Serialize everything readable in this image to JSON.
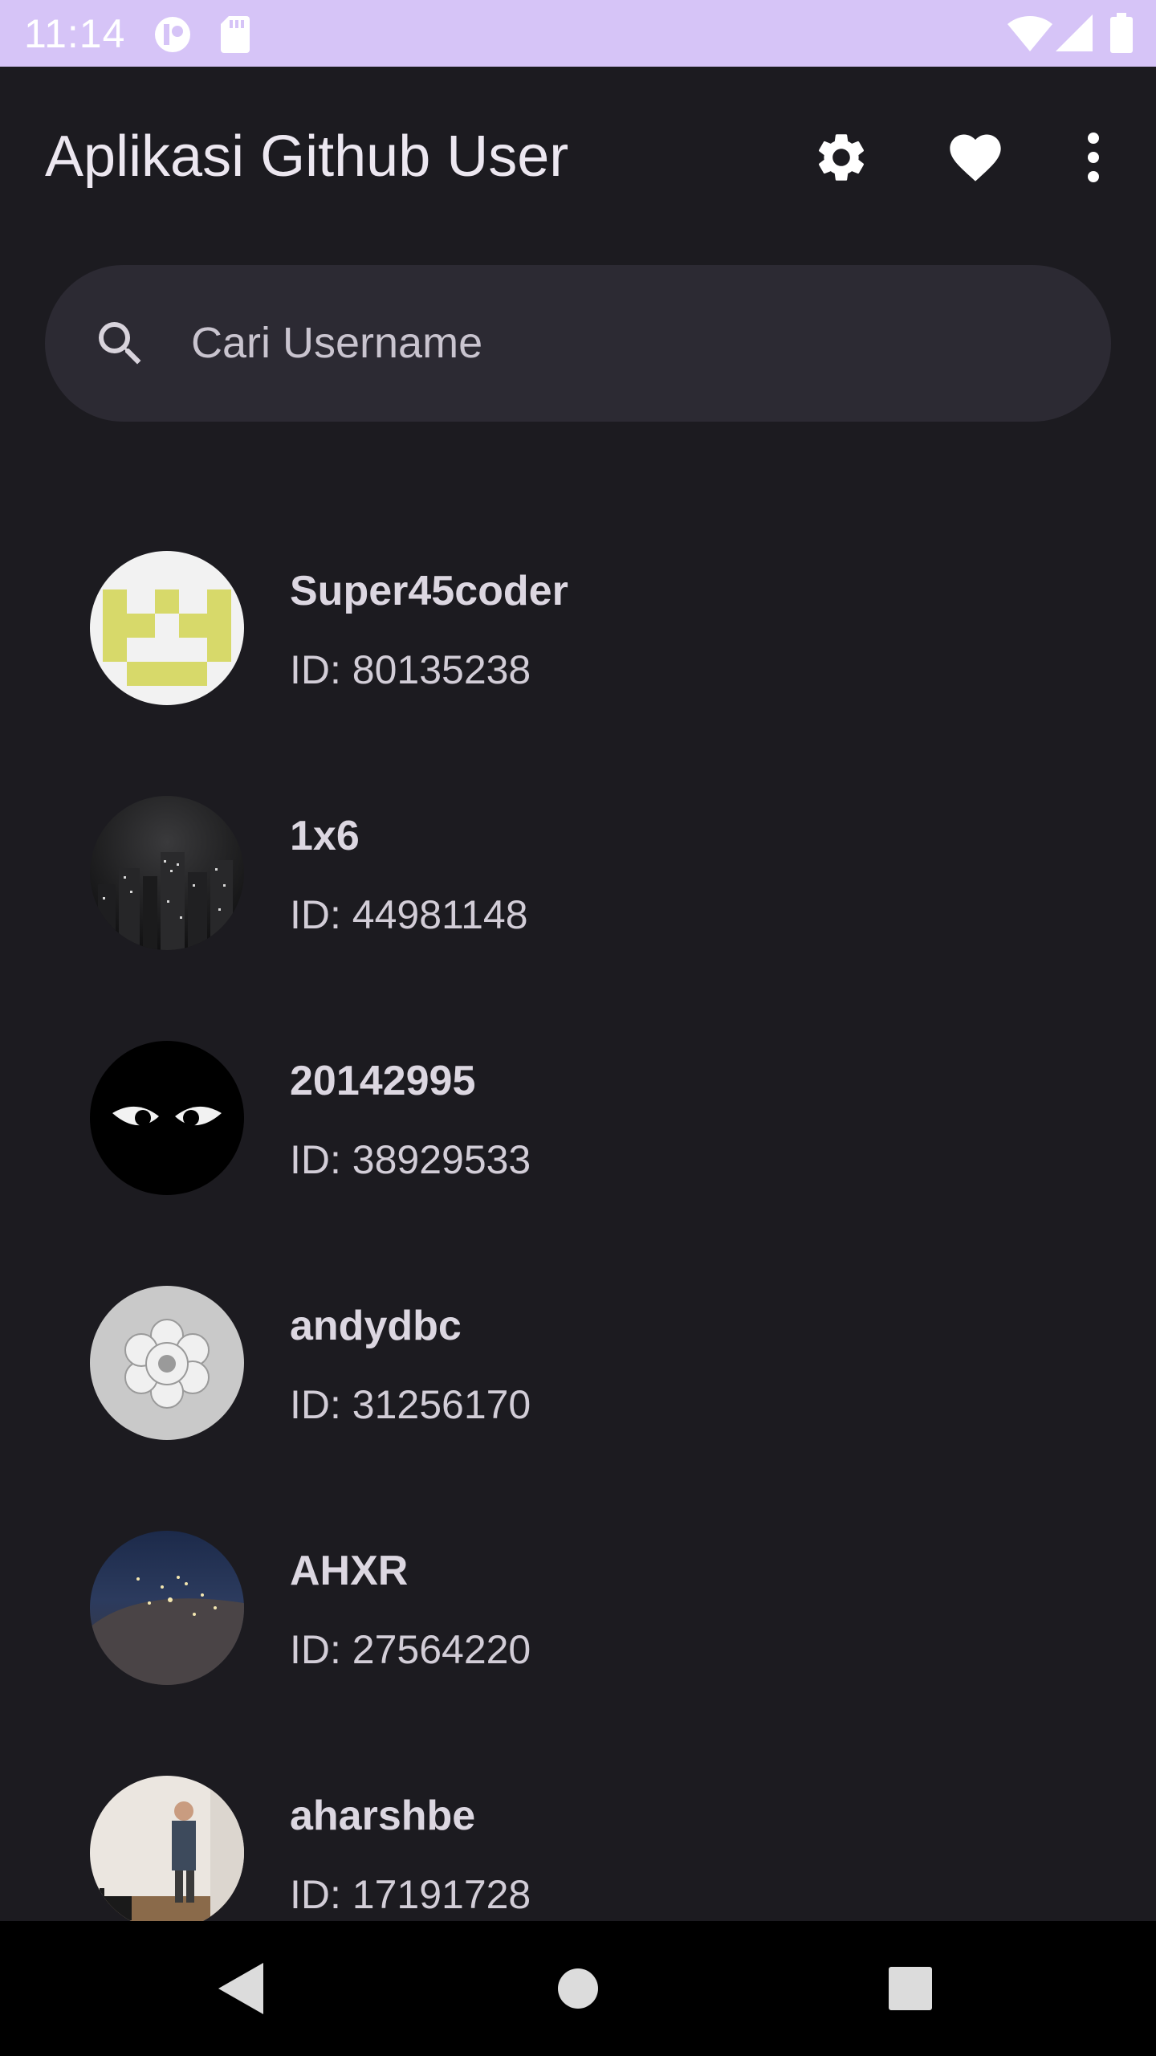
{
  "status_bar": {
    "time": "11:14",
    "background": "#d6c4f7",
    "icons": [
      "notification-app-icon",
      "sd-card-icon",
      "wifi-icon",
      "signal-icon",
      "battery-icon"
    ]
  },
  "app_bar": {
    "title": "Aplikasi Github User",
    "actions": [
      "gear-icon",
      "heart-icon",
      "more-vert-icon"
    ]
  },
  "search": {
    "placeholder": "Cari Username",
    "icon": "search-icon"
  },
  "users": [
    {
      "username": "Super45coder",
      "id": "ID: 80135238"
    },
    {
      "username": "1x6",
      "id": "ID: 44981148"
    },
    {
      "username": "20142995",
      "id": "ID: 38929533"
    },
    {
      "username": "andydbc",
      "id": "ID: 31256170"
    },
    {
      "username": "AHXR",
      "id": "ID: 27564220"
    },
    {
      "username": "aharshbe",
      "id": "ID: 17191728"
    }
  ],
  "nav_bar": {
    "buttons": [
      "back-icon",
      "home-icon",
      "recents-icon"
    ]
  },
  "colors": {
    "background": "#1c1b20",
    "search_background": "#2c2a33",
    "text_primary": "#ece7f0"
  }
}
